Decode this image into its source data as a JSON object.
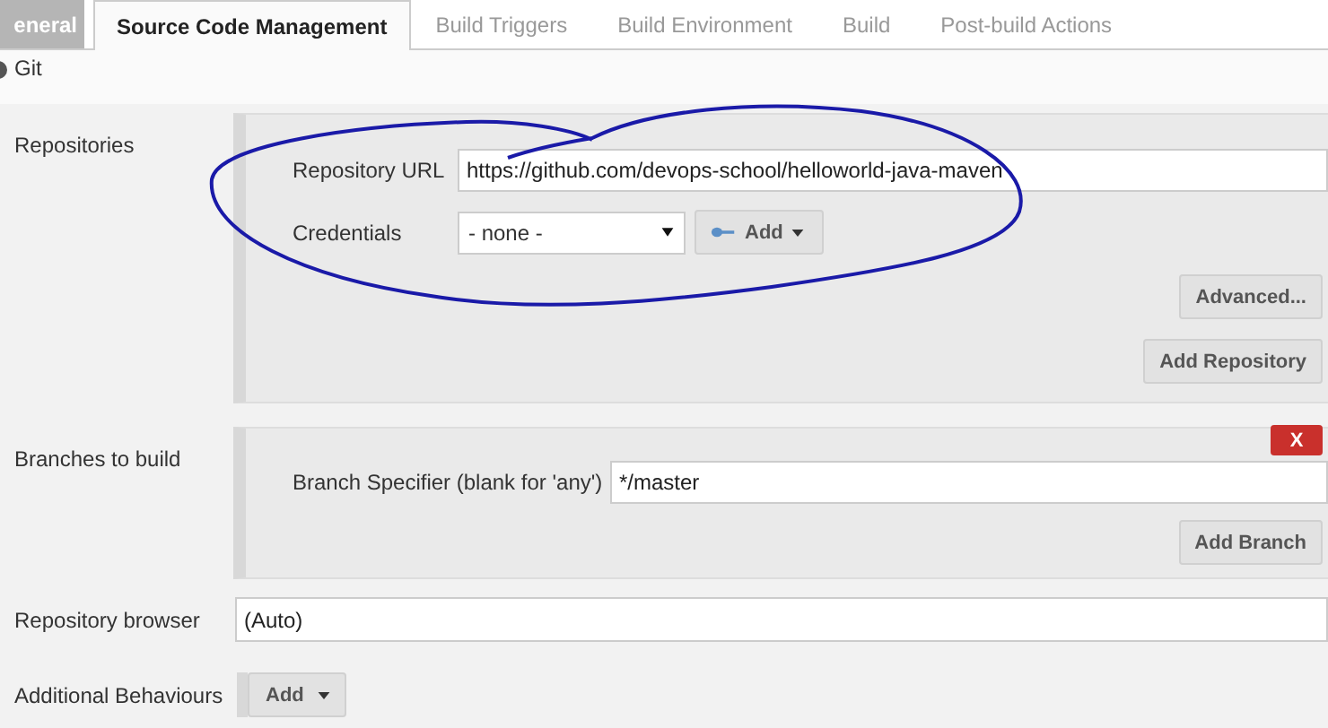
{
  "tabs": [
    {
      "label": "eneral",
      "selected": false
    },
    {
      "label": "Source Code Management",
      "selected": true
    },
    {
      "label": "Build Triggers",
      "selected": false
    },
    {
      "label": "Build Environment",
      "selected": false
    },
    {
      "label": "Build",
      "selected": false
    },
    {
      "label": "Post-build Actions",
      "selected": false
    }
  ],
  "scm": {
    "label": "Git",
    "selected": true
  },
  "repositories": {
    "label": "Repositories",
    "url_label": "Repository URL",
    "url": "https://github.com/devops-school/helloworld-java-maven",
    "credentials_label": "Credentials",
    "credentials": "- none -",
    "add_button": "Add",
    "advanced_button": "Advanced...",
    "add_repository_button": "Add Repository"
  },
  "branches": {
    "label": "Branches to build",
    "delete_button": "X",
    "specifier_label": "Branch Specifier (blank for 'any')",
    "specifier": "*/master",
    "add_branch_button": "Add Branch"
  },
  "repository_browser": {
    "label": "Repository browser",
    "value": "(Auto)"
  },
  "additional_behaviours": {
    "label": "Additional Behaviours",
    "add_button": "Add"
  },
  "annotation": {
    "kind": "ellipse"
  }
}
